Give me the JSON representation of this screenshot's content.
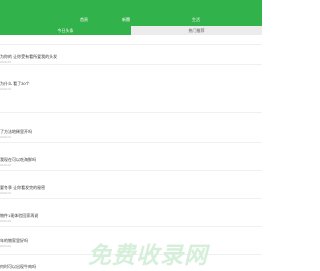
{
  "nav": {
    "items": [
      "首頁",
      "新聞",
      "生活"
    ]
  },
  "tabs": [
    "今日头条",
    "热门推荐"
  ],
  "list": [
    {
      "title": "",
      "meta": ""
    },
    {
      "title": "为你的 让你受有看所爱我的头发",
      "meta": "2020-02"
    },
    {
      "title": "为什么 看了30个",
      "meta": "2020-02"
    },
    {
      "title": "了方法地稀里开吗",
      "meta": "2020-02"
    },
    {
      "title": "我现在可以吃海鲜吗",
      "meta": "2020-02"
    },
    {
      "title": "要冬季 让你看发完的秘密",
      "meta": "2020-02"
    },
    {
      "title": "物件1现体验回家再说",
      "meta": "2020-02"
    },
    {
      "title": "年的物家里好吗",
      "meta": "2020-02"
    },
    {
      "title": "何时可以出现牛肉吗",
      "meta": "2020-02"
    }
  ],
  "watermark": "免费收录网"
}
